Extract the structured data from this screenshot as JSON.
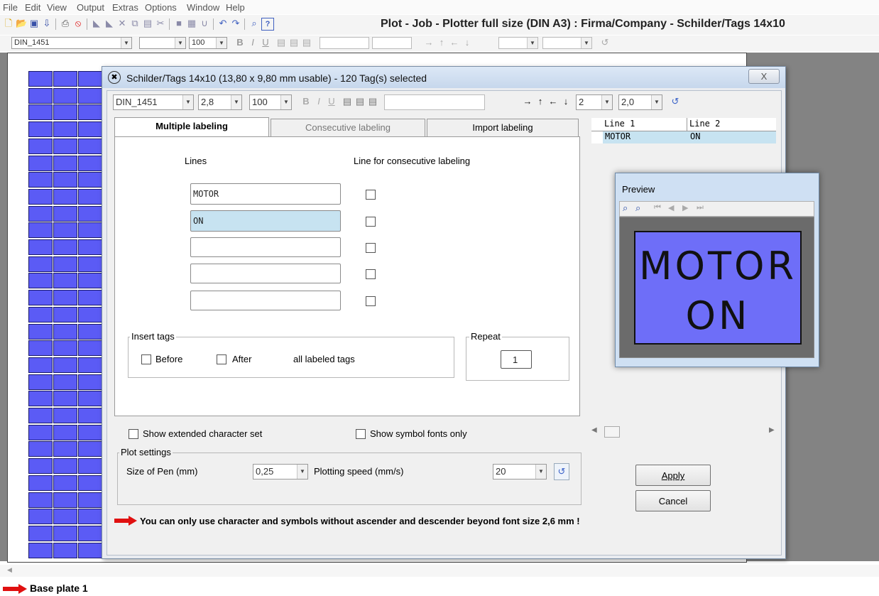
{
  "menu": [
    "File",
    "Edit",
    "View",
    "Output",
    "Extras",
    "Options",
    "Window",
    "Help"
  ],
  "job_title": "Plot - Job - Plotter full size (DIN A3)  :  Firma/Company - Schilder/Tags 14x10",
  "toolbar2": {
    "font": "DIN_1451",
    "size": "",
    "zoom": "100"
  },
  "dialog": {
    "title": "Schilder/Tags 14x10 (13,80 x 9,80 mm usable) - 120 Tag(s) selected",
    "close_label": "X",
    "font": "DIN_1451",
    "font_size": "2,8",
    "scale": "100",
    "lines_count": "2",
    "line_spacing": "2,0",
    "tabs": [
      "Multiple labeling",
      "Consecutive labeling",
      "Import labeling"
    ],
    "lines_header": "Lines",
    "consecutive_header": "Line for consecutive labeling",
    "lines": [
      "MOTOR",
      "ON",
      "",
      "",
      ""
    ],
    "insert_tags": {
      "label": "Insert tags",
      "before": "Before",
      "after": "After",
      "suffix": "all labeled tags"
    },
    "repeat": {
      "label": "Repeat",
      "value": "1"
    },
    "show_extended": "Show extended character set",
    "show_symbol": "Show symbol fonts only",
    "plot_settings": {
      "label": "Plot settings",
      "pen_label": "Size of Pen (mm)",
      "pen_value": "0,25",
      "speed_label": "Plotting speed (mm/s)",
      "speed_value": "20"
    },
    "apply": "Apply",
    "cancel": "Cancel",
    "warning": "You can only use character and symbols without ascender and descender beyond font size 2,6 mm !",
    "table": {
      "headers": [
        "Line 1",
        "Line 2"
      ],
      "row": [
        "MOTOR",
        "ON"
      ]
    }
  },
  "preview": {
    "title": "Preview",
    "line1": "MOTOR",
    "line2": "ON",
    "tag_color": "#6e6ef8"
  },
  "footer": {
    "tab": "Base plate 1"
  }
}
